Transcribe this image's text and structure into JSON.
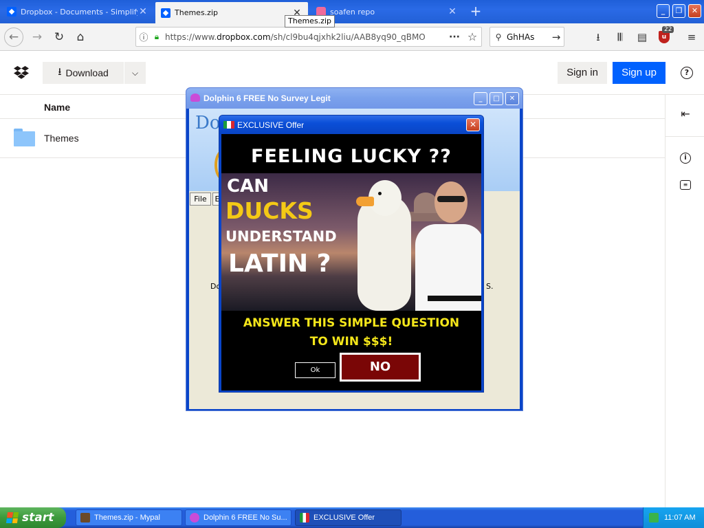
{
  "browser": {
    "tabs": [
      {
        "title": "Dropbox - Documents - Simplify y",
        "icon": "dropbox-icon"
      },
      {
        "title": "Themes.zip",
        "icon": "dropbox-icon"
      },
      {
        "title": "soafen repo",
        "icon": "page-icon"
      }
    ],
    "new_tab_label": "+",
    "tooltip": "Themes.zip",
    "url_prefix": "https://www.",
    "url_host": "dropbox.com",
    "url_rest": "/sh/cl9bu4qjxhk2liu/AAB8yq90_qBMO",
    "search_value": "GhHAs",
    "addon_badge": "22"
  },
  "dropbox": {
    "download_label": "Download",
    "signin_label": "Sign in",
    "signup_label": "Sign up",
    "column_name": "Name",
    "items": [
      {
        "name": "Themes",
        "type": "folder"
      }
    ]
  },
  "dolphin_window": {
    "title": "Dolphin 6 FREE No Survey Legit",
    "banner_text": "Do",
    "menu_file": "File",
    "menu_edit": "E",
    "body_left": "Do",
    "body_right": "S."
  },
  "offer_popup": {
    "title": "EXCLUSIVE Offer",
    "headline": "FEELING LUCKY ??",
    "image_captions": [
      "CAN",
      "DUCKS",
      "UNDERSTAND",
      "LATIN ?"
    ],
    "question_line1": "ANSWER THIS SIMPLE QUESTION",
    "question_line2": "TO WIN $$$!",
    "ok_label": "Ok",
    "no_label": "NO",
    "colors": {
      "headline": "#ffffff",
      "ducks": "#f4c916",
      "question": "#f4e61a",
      "no_button": "#7a0606"
    }
  },
  "taskbar": {
    "start_label": "start",
    "tasks": [
      {
        "label": "Themes.zip - Mypal"
      },
      {
        "label": "Dolphin 6 FREE No Su..."
      },
      {
        "label": "EXCLUSIVE Offer"
      }
    ],
    "clock": "11:07 AM"
  }
}
